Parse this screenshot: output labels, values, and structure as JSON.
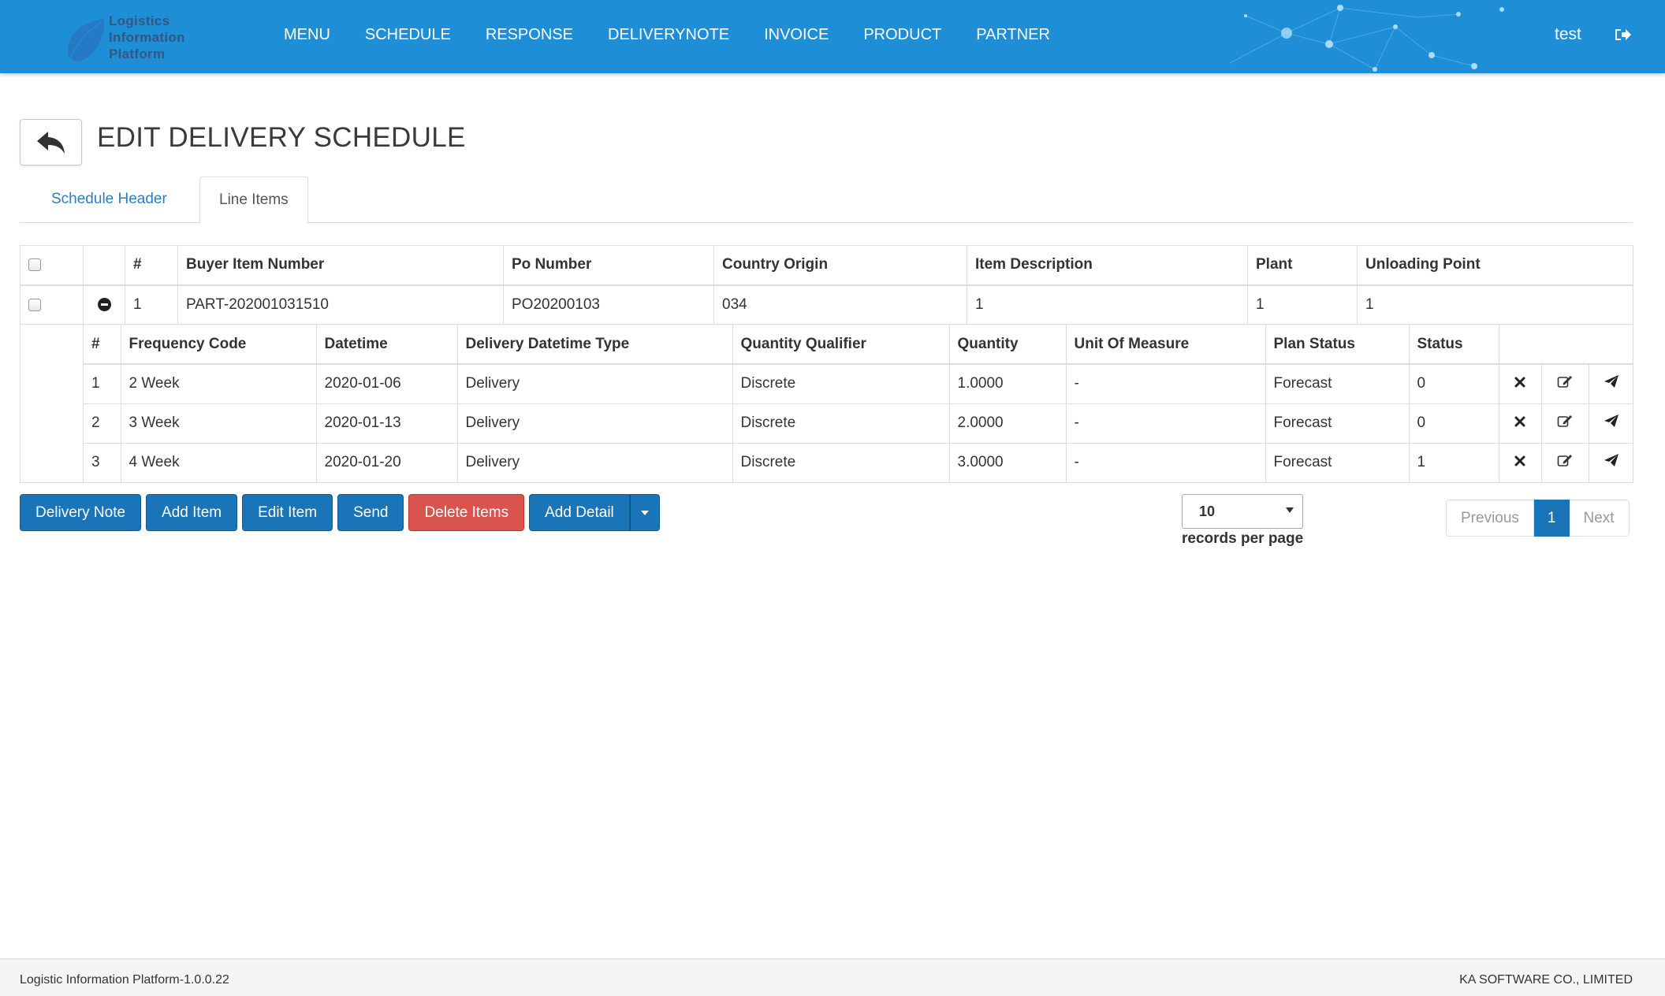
{
  "app": {
    "logo_text": "Logistics\nInformation\nPlatform"
  },
  "nav": {
    "items": [
      "MENU",
      "SCHEDULE",
      "RESPONSE",
      "DELIVERYNOTE",
      "INVOICE",
      "PRODUCT",
      "PARTNER"
    ],
    "user": "test",
    "logout_icon": "sign-out-icon",
    "color": "#1e8fd6"
  },
  "page": {
    "title": "EDIT DELIVERY SCHEDULE",
    "back_icon": "reply-icon"
  },
  "tabs": [
    {
      "label": "Schedule Header",
      "active": false
    },
    {
      "label": "Line Items",
      "active": true
    }
  ],
  "line_items": {
    "columns": [
      "#",
      "Buyer Item Number",
      "Po Number",
      "Country Origin",
      "Item Description",
      "Plant",
      "Unloading Point"
    ],
    "rows": [
      {
        "no": "1",
        "buyer_item_number": "PART-202001031510",
        "po_number": "PO20200103",
        "country_origin": "034",
        "item_description": "1",
        "plant": "1",
        "unloading_point": "1"
      }
    ]
  },
  "details": {
    "columns": [
      "#",
      "Frequency Code",
      "Datetime",
      "Delivery Datetime Type",
      "Quantity Qualifier",
      "Quantity",
      "Unit Of Measure",
      "Plan Status",
      "Status"
    ],
    "rows": [
      {
        "no": "1",
        "frequency_code": "2 Week",
        "datetime": "2020-01-06",
        "delivery_datetime_type": "Delivery",
        "quantity_qualifier": "Discrete",
        "quantity": "1.0000",
        "unit_of_measure": "-",
        "plan_status": "Forecast",
        "status": "0"
      },
      {
        "no": "2",
        "frequency_code": "3 Week",
        "datetime": "2020-01-13",
        "delivery_datetime_type": "Delivery",
        "quantity_qualifier": "Discrete",
        "quantity": "2.0000",
        "unit_of_measure": "-",
        "plan_status": "Forecast",
        "status": "0"
      },
      {
        "no": "3",
        "frequency_code": "4 Week",
        "datetime": "2020-01-20",
        "delivery_datetime_type": "Delivery",
        "quantity_qualifier": "Discrete",
        "quantity": "3.0000",
        "unit_of_measure": "-",
        "plan_status": "Forecast",
        "status": "1"
      }
    ],
    "row_actions": [
      "times-icon",
      "edit-icon",
      "send-icon"
    ]
  },
  "buttons": {
    "delivery_note": "Delivery Note",
    "add_item": "Add Item",
    "edit_item": "Edit Item",
    "send": "Send",
    "delete_items": "Delete Items",
    "add_detail": "Add Detail",
    "primary_color": "#1a74b8",
    "danger_color": "#d9534f"
  },
  "pagination": {
    "page_size": "10",
    "records_label": "records per page",
    "previous": "Previous",
    "current": "1",
    "next": "Next"
  },
  "footer": {
    "version": "Logistic Information Platform-1.0.0.22",
    "company": "KA SOFTWARE CO., LIMITED"
  }
}
